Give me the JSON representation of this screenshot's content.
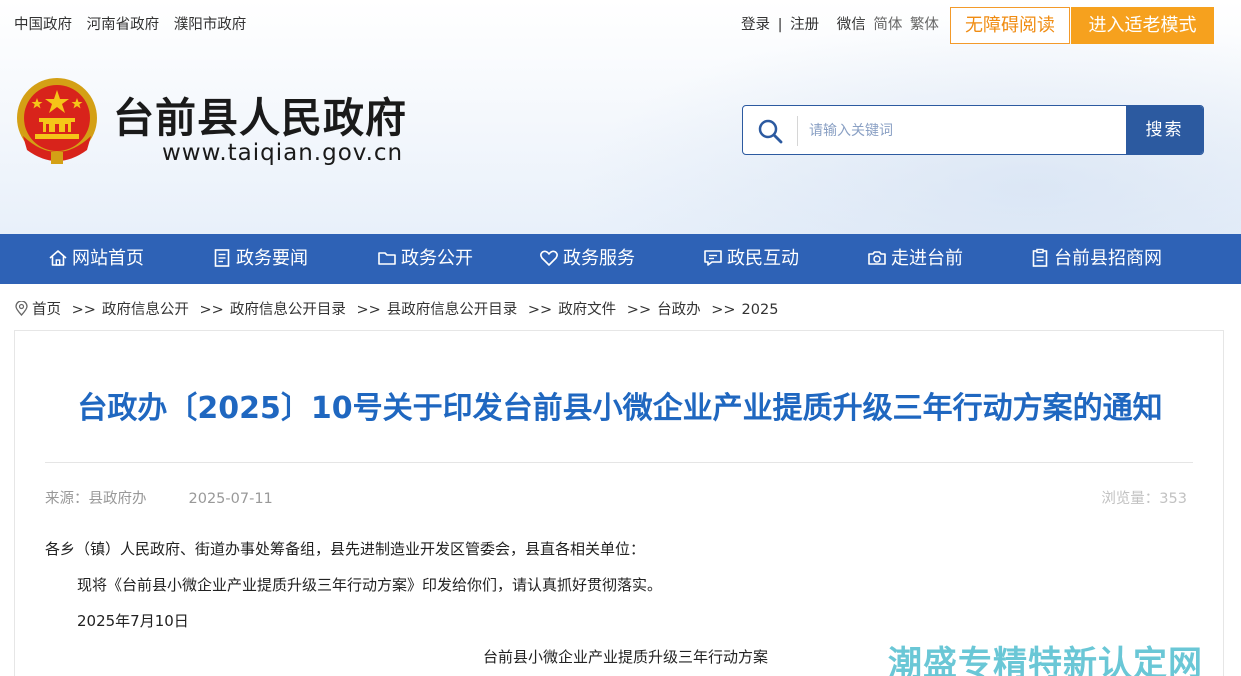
{
  "top_links": [
    "中国政府",
    "河南省政府",
    "濮阳市政府"
  ],
  "user_links": {
    "login": "登录",
    "separator": "|",
    "register": "注册",
    "wechat": "微信",
    "simplified": "简体",
    "traditional": "繁体"
  },
  "accessibility_button": "无障碍阅读",
  "elder_mode_button": "进入适老模式",
  "site": {
    "title": "台前县人民政府",
    "url": "www.taiqian.gov.cn"
  },
  "search": {
    "placeholder": "请输入关键词",
    "button": "搜索"
  },
  "nav": [
    {
      "label": "网站首页",
      "icon": "home-icon"
    },
    {
      "label": "政务要闻",
      "icon": "document-icon"
    },
    {
      "label": "政务公开",
      "icon": "folder-icon"
    },
    {
      "label": "政务服务",
      "icon": "heart-icon"
    },
    {
      "label": "政民互动",
      "icon": "message-icon"
    },
    {
      "label": "走进台前",
      "icon": "camera-icon"
    },
    {
      "label": "台前县招商网",
      "icon": "clipboard-icon"
    }
  ],
  "breadcrumb": {
    "separator": ">>",
    "items": [
      "首页",
      "政府信息公开",
      "政府信息公开目录",
      "县政府信息公开目录",
      "政府文件",
      "台政办",
      "2025"
    ]
  },
  "article": {
    "title": "台政办〔2025〕10号关于印发台前县小微企业产业提质升级三年行动方案的通知",
    "source": "来源：县政府办",
    "date": "2025-07-11",
    "views": "浏览量：353",
    "salutation": "各乡（镇）人民政府、街道办事处筹备组，县先进制造业开发区管委会，县直各相关单位：",
    "paragraph": "现将《台前县小微企业产业提质升级三年行动方案》印发给你们，请认真抓好贯彻落实。",
    "sign_date": "2025年7月10日",
    "attachment_title": "台前县小微企业产业提质升级三年行动方案"
  },
  "watermark": "潮盛专精特新认定网",
  "colors": {
    "nav": "#2e62b6",
    "title": "#1f67c0",
    "accent_orange": "#f6a11e",
    "search_border": "#2c5aa0"
  }
}
